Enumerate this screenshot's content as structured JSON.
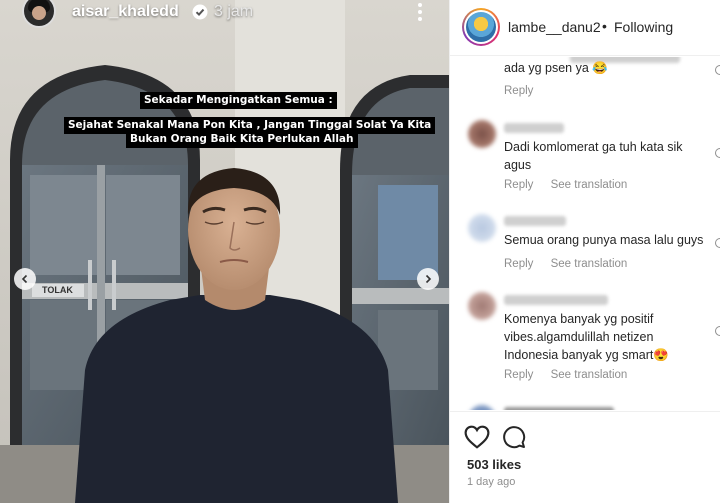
{
  "story": {
    "username": "aisar_khaledd",
    "time": "3 jam",
    "caption_lines": [
      "Sekadar Mengingatkan Semua :",
      "Sejahat Senakal Mana Pon Kita , Jangan Tinggal Solat Ya Kita",
      "Bukan Orang Baik Kita Perlukan Allah"
    ],
    "door_sign": "TOLAK"
  },
  "post": {
    "username": "lambe__danu2",
    "separator": "•",
    "follow_status": "Following"
  },
  "comments": [
    {
      "text": "ada yg psen ya 😂",
      "actions": [
        "Reply"
      ]
    },
    {
      "text": "Dadi komlomerat ga tuh kata sik\nagus",
      "actions": [
        "Reply",
        "See translation"
      ]
    },
    {
      "text": "Semua orang punya masa lalu guys",
      "actions": [
        "Reply",
        "See translation"
      ]
    },
    {
      "text": "Komenya banyak yg positif\nvibes.algamdulillah netizen\nIndonesia banyak yg smart😍",
      "actions": [
        "Reply",
        "See translation"
      ]
    }
  ],
  "footer": {
    "likes": "503 likes",
    "posted": "1 day ago"
  },
  "colors": {
    "text": "#262626",
    "muted": "#8e8e8e",
    "verified": "#3897f0"
  }
}
